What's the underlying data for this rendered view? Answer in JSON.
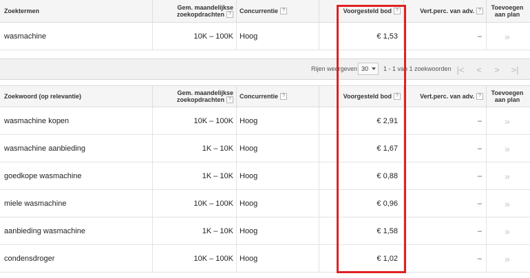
{
  "top_table": {
    "headers": {
      "term": "Zoektermen",
      "searches_line1": "Gem. maandelijkse",
      "searches_line2": "zoekopdrachten",
      "competition": "Concurrentie",
      "bid": "Voorgesteld bod",
      "share": "Vert.perc. van adv.",
      "add_line1": "Toevoegen",
      "add_line2": "aan plan"
    },
    "rows": [
      {
        "term": "wasmachine",
        "searches": "10K – 100K",
        "competition": "Hoog",
        "bid": "€ 1,53",
        "share": "–",
        "add": "»"
      }
    ]
  },
  "pager": {
    "rows_label": "Rijen weergeven:",
    "rows_value": "30",
    "range_text": "1 - 1 van 1 zoekwoorden",
    "first": "|<",
    "prev": "<",
    "next": ">",
    "last": ">|"
  },
  "bottom_table": {
    "headers": {
      "term": "Zoekwoord (op relevantie)",
      "searches_line1": "Gem. maandelijkse",
      "searches_line2": "zoekopdrachten",
      "competition": "Concurrentie",
      "bid": "Voorgesteld bod",
      "share": "Vert.perc. van adv.",
      "add_line1": "Toevoegen",
      "add_line2": "aan plan"
    },
    "rows": [
      {
        "term": "wasmachine kopen",
        "searches": "10K – 100K",
        "competition": "Hoog",
        "bid": "€ 2,91",
        "share": "–",
        "add": "»"
      },
      {
        "term": "wasmachine aanbieding",
        "searches": "1K – 10K",
        "competition": "Hoog",
        "bid": "€ 1,67",
        "share": "–",
        "add": "»"
      },
      {
        "term": "goedkope wasmachine",
        "searches": "1K – 10K",
        "competition": "Hoog",
        "bid": "€ 0,88",
        "share": "–",
        "add": "»"
      },
      {
        "term": "miele wasmachine",
        "searches": "10K – 100K",
        "competition": "Hoog",
        "bid": "€ 0,96",
        "share": "–",
        "add": "»"
      },
      {
        "term": "aanbieding wasmachine",
        "searches": "1K – 10K",
        "competition": "Hoog",
        "bid": "€ 1,58",
        "share": "–",
        "add": "»"
      },
      {
        "term": "condensdroger",
        "searches": "10K – 100K",
        "competition": "Hoog",
        "bid": "€ 1,02",
        "share": "–",
        "add": "»"
      }
    ]
  },
  "help_icon": "?",
  "highlight_color": "#e02020"
}
